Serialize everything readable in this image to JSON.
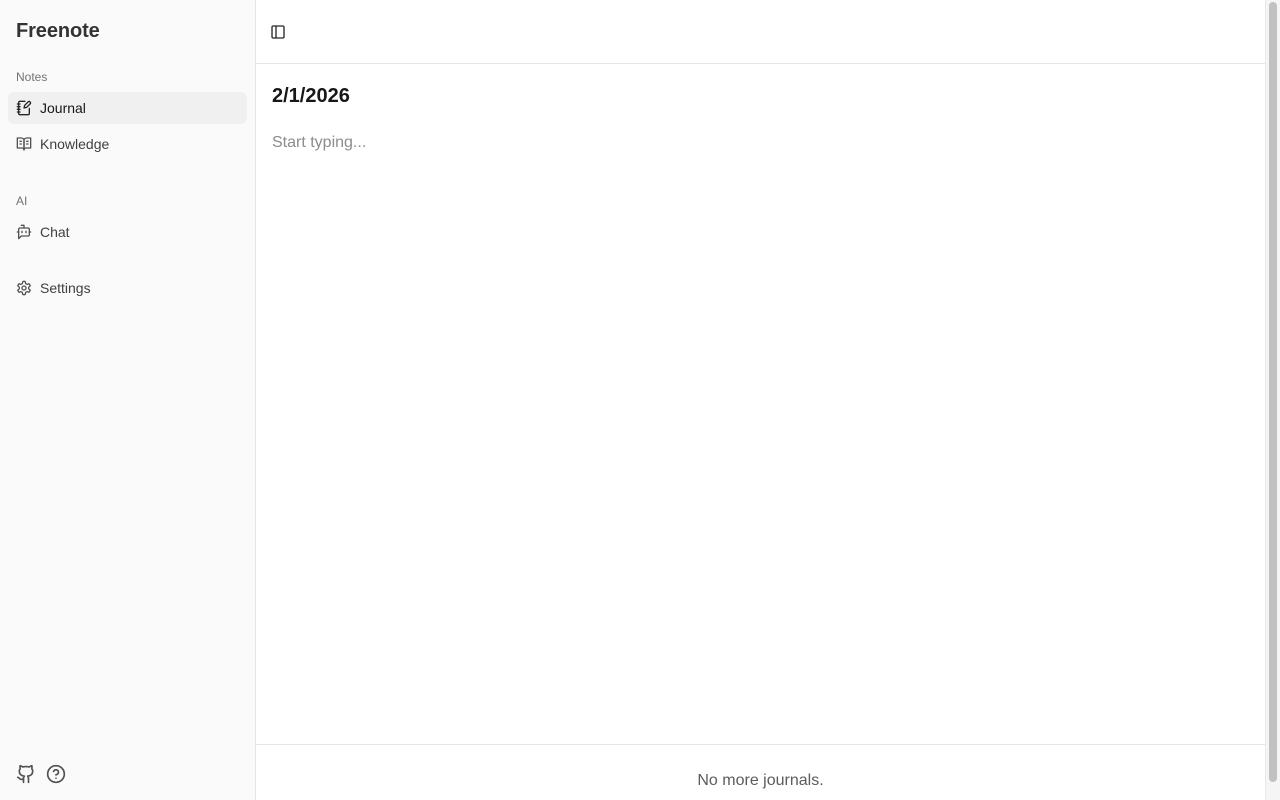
{
  "app": {
    "name": "Freenote"
  },
  "sidebar": {
    "groups": [
      {
        "label": "Notes"
      },
      {
        "label": "AI"
      }
    ],
    "items": [
      {
        "label": "Journal",
        "icon": "notebook-pen-icon",
        "active": true
      },
      {
        "label": "Knowledge",
        "icon": "book-open-icon",
        "active": false
      },
      {
        "label": "Chat",
        "icon": "bot-message-icon",
        "active": false
      },
      {
        "label": "Settings",
        "icon": "gear-icon",
        "active": false
      }
    ],
    "footer_icons": [
      "github-icon",
      "help-circle-icon"
    ]
  },
  "main": {
    "toolbar": {
      "toggle_icon": "panel-left-icon"
    },
    "journal": {
      "date": "2/1/2026",
      "editor_placeholder": "Start typing...",
      "editor_value": ""
    },
    "end_message": "No more journals."
  },
  "colors": {
    "sidebar_bg": "#fafafa",
    "active_item_bg": "#f0f0f0",
    "border": "#e5e5e5"
  }
}
